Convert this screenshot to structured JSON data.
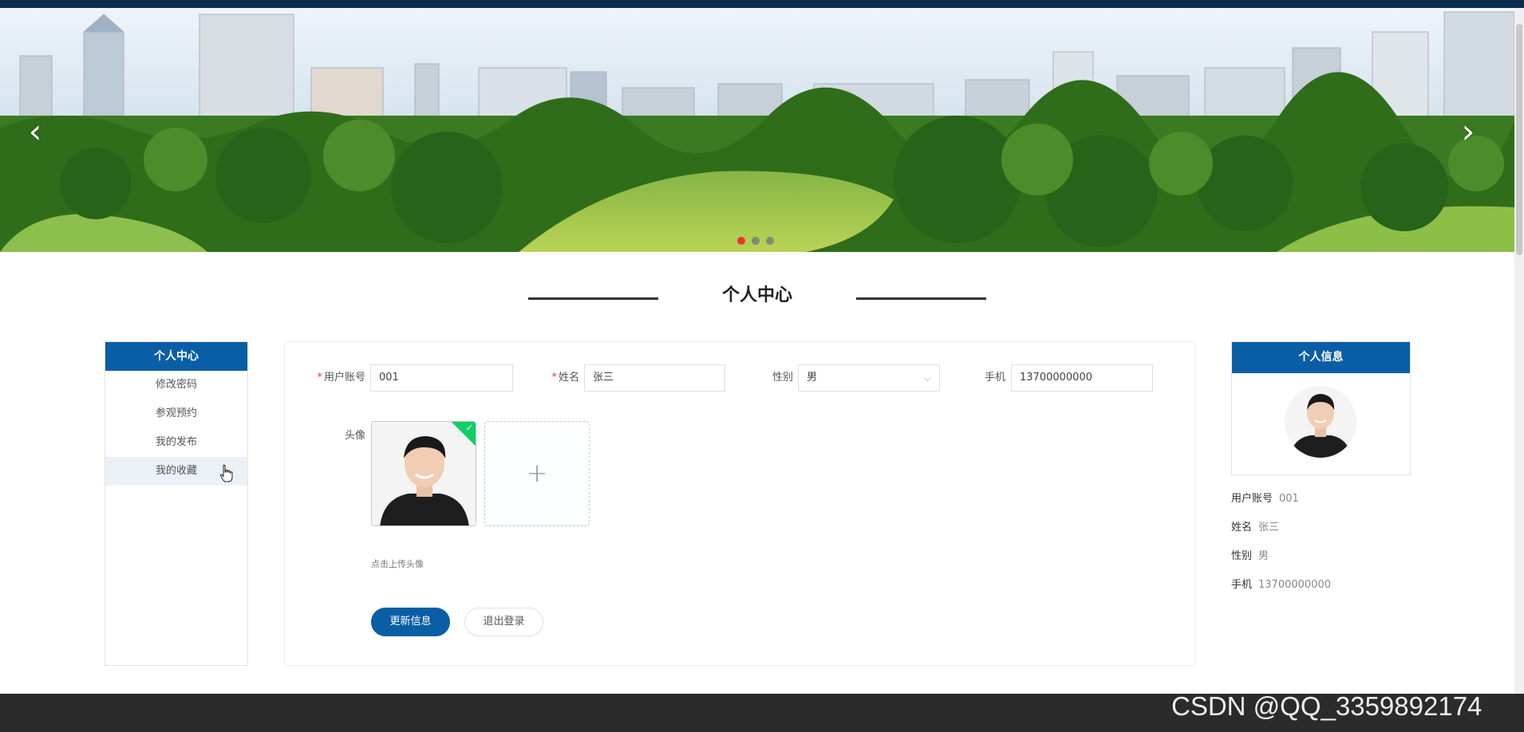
{
  "banner": {
    "prev_icon": "chevron-left-icon",
    "next_icon": "chevron-right-icon",
    "prev_glyph": "‹",
    "next_glyph": "›",
    "dots": 3,
    "active_dot": 0,
    "active_color": "#e53935"
  },
  "section": {
    "title": "个人中心"
  },
  "left_menu": {
    "header": "个人中心",
    "items": [
      "修改密码",
      "参观预约",
      "我的发布",
      "我的收藏"
    ],
    "hovered_index": 3
  },
  "form": {
    "account": {
      "label": "用户账号",
      "value": "001",
      "required": "*"
    },
    "name": {
      "label": "姓名",
      "value": "张三",
      "required": "*"
    },
    "gender": {
      "label": "性别",
      "value": "男",
      "arrow": "⌵"
    },
    "phone": {
      "label": "手机",
      "value": "13700000000"
    },
    "avatar": {
      "label": "头像",
      "upload_tip": "点击上传头像",
      "plus": "+",
      "check": "✓"
    },
    "update_button": "更新信息",
    "logout_button": "退出登录"
  },
  "info": {
    "header": "个人信息",
    "rows": [
      {
        "key": "用户账号",
        "value": "001"
      },
      {
        "key": "姓名",
        "value": "张三"
      },
      {
        "key": "性别",
        "value": "男"
      },
      {
        "key": "手机",
        "value": "13700000000"
      }
    ]
  },
  "footer": {
    "watermark": "CSDN @QQ_3359892174"
  },
  "colors": {
    "primary": "#0a5ea6",
    "topbar": "#0b2e4f",
    "footer": "#2b2b2b",
    "required": "#e53935",
    "success": "#13ce66"
  }
}
